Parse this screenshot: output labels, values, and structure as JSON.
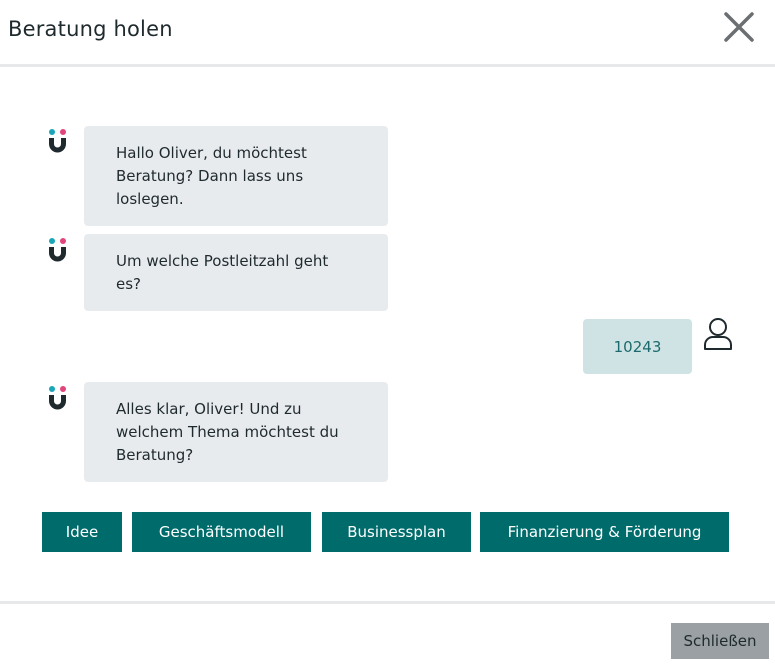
{
  "header": {
    "title": "Beratung holen",
    "close_icon": "close-icon"
  },
  "chat": {
    "bot_icon": "magnet-logo-icon",
    "user_icon": "user-icon",
    "messages": [
      {
        "from": "bot",
        "lines": [
          "Hallo Oliver, du möchtest",
          "Beratung? Dann lass uns",
          "loslegen."
        ]
      },
      {
        "from": "bot",
        "lines": [
          "Um welche Postleitzahl geht",
          "es?"
        ]
      },
      {
        "from": "user",
        "text": "10243"
      },
      {
        "from": "bot",
        "lines": [
          "Alles klar, Oliver! Und zu",
          "welchem Thema möchtest du",
          "Beratung?"
        ]
      }
    ],
    "options": [
      "Idee",
      "Geschäftsmodell",
      "Businessplan",
      "Finanzierung & Förderung"
    ]
  },
  "footer": {
    "close_label": "Schließen"
  },
  "colors": {
    "accent": "#006b6b",
    "bot_bubble": "#e8ebee",
    "user_bubble": "#cfe3e4",
    "logo_teal": "#1aa6b7",
    "logo_pink": "#e0457b"
  }
}
